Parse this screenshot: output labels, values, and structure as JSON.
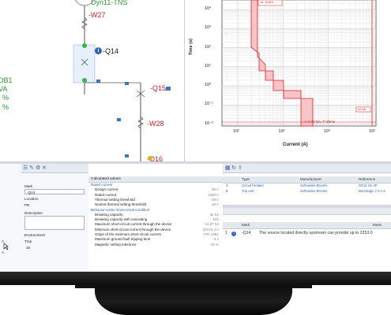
{
  "schematic": {
    "transformer_label": "Dyn11-TNS",
    "w27": "-W27",
    "q14_badge": "i",
    "q14": "-Q14",
    "q15": "-Q15",
    "w28": "-W28",
    "q16": "-Q16",
    "left_partial_1": "DB1",
    "left_partial_2": "VA",
    "left_partial_3": "%",
    "left_partial_4": "%"
  },
  "tcc": {
    "y_axis_label": "Time (s)",
    "x_axis_label": "Current (A)",
    "y_ticks": [
      "10⁴",
      "10³",
      "10²",
      "10¹",
      "10⁰",
      "10⁻¹",
      "10⁻²"
    ],
    "x_ticks": [
      "10²",
      "10³",
      "10⁴",
      "10⁵"
    ],
    "annotation_top": "Ik: 12.8 k",
    "annotation_right": "42 kA",
    "annotation_bottom": "I: 4.70 NA, T: 20ms",
    "colors": {
      "curve": "#e0202a",
      "band": "#f5b8bc",
      "grid": "#d9d9d9"
    }
  },
  "properties": {
    "mark_label": "Mark",
    "mark_value": "-Q14",
    "location_label": "Location",
    "location_value": "PR",
    "description_label": "Description",
    "description_value": "",
    "environment_label": "Environment",
    "temp_label": "Tmp",
    "temp_value": "15",
    "left_partial_a": "A",
    "left_partial_b": "A"
  },
  "calculated": {
    "header": "Calculated values",
    "section1": "Rated current",
    "rows1": [
      {
        "name": "Design current",
        "value": "48 A"
      },
      {
        "name": "Rated current",
        "value": "1600 A"
      },
      {
        "name": "Thermal setting threshold",
        "value": "48 A"
      },
      {
        "name": "Neutral thermal setting threshold",
        "value": "48 A"
      }
    ],
    "section2": "Behavior under short-circuit condition",
    "rows2": [
      {
        "name": "Breaking capacity",
        "value": "42 kA"
      },
      {
        "name": "Breaking capacity with cascading",
        "value": "N/A"
      },
      {
        "name": "Maximum short-circuit current through the device",
        "value": "34.87 kA"
      },
      {
        "name": "Minimum short-circuit current through the device",
        "value": "23173.3 A"
      },
      {
        "name": "Origin of the minimum short-circuit current",
        "value": "+PR.-DB1"
      },
      {
        "name": "Maximum ground fault tripping time",
        "value": "5 s"
      },
      {
        "name": "Magnetic setting tolerance",
        "value": "10 %"
      }
    ]
  },
  "products": {
    "headers": {
      "type": "Type",
      "manufacturer": "Manufacturer",
      "reference": "Reference"
    },
    "rows": [
      {
        "num": "1",
        "type": "Circuit breaker",
        "manufacturer": "Schneider Electric",
        "reference": "NT16 H1 4P"
      },
      {
        "num": "2",
        "type": "Trip unit",
        "manufacturer": "Schneider Electric",
        "reference": "Micrologic 7.0 A 3"
      }
    ]
  },
  "messages": {
    "headers": {
      "mark": "Mark",
      "message": "Mess"
    },
    "rows": [
      {
        "num": "1",
        "mark": "-Q14",
        "message": "The source located directly upstream can provide up to 2253.0"
      }
    ]
  }
}
